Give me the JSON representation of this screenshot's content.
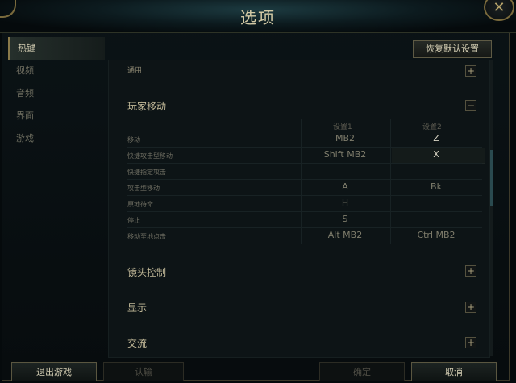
{
  "window": {
    "title": "选项"
  },
  "sidebar": {
    "items": [
      {
        "label": "热键"
      },
      {
        "label": "视频"
      },
      {
        "label": "音频"
      },
      {
        "label": "界面"
      },
      {
        "label": "游戏"
      }
    ]
  },
  "toolbar": {
    "reset_label": "恢复默认设置"
  },
  "sections": {
    "top_partial": "通用",
    "player_movement": "玩家移动",
    "camera": "镜头控制",
    "display": "显示",
    "communication": "交流"
  },
  "table": {
    "columns": [
      "设置1",
      "设置2"
    ],
    "rows": [
      {
        "label": "移动",
        "s1": "MB2",
        "s2": "Z"
      },
      {
        "label": "快捷攻击型移动",
        "s1": "Shift MB2",
        "s2": "X"
      },
      {
        "label": "快捷指定攻击",
        "s1": "",
        "s2": ""
      },
      {
        "label": "攻击型移动",
        "s1": "A",
        "s2": "Bk"
      },
      {
        "label": "原地待命",
        "s1": "H",
        "s2": ""
      },
      {
        "label": "停止",
        "s1": "S",
        "s2": ""
      },
      {
        "label": "移动至地点击",
        "s1": "Alt MB2",
        "s2": "Ctrl MB2"
      }
    ]
  },
  "footer": {
    "exit_label": "退出游戏",
    "confirm_label": "认输",
    "ok_label": "确定",
    "cancel_label": "取消"
  },
  "icons": {
    "collapse": "minus-icon",
    "expand": "plus-icon",
    "close": "close-icon"
  },
  "colors": {
    "accent": "#8a7a4a",
    "background": "#0d1416"
  }
}
